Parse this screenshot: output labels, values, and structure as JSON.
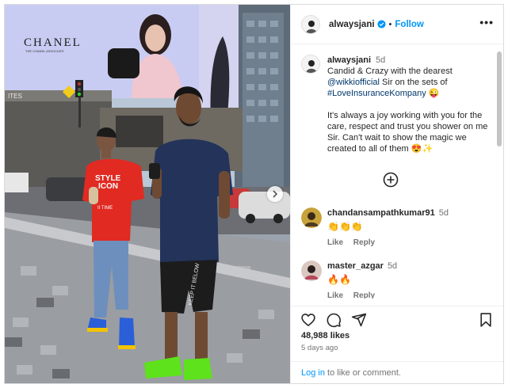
{
  "post": {
    "username": "alwaysjani",
    "follow_label": "Follow",
    "more_label": "•••"
  },
  "photo": {
    "billboard_brand": "CHANEL",
    "billboard_sub": "THE CHANEL ASSOCIATE",
    "storefront_text": "ITES",
    "shirt_text_line1": "STYLE",
    "shirt_text_line2": "ICON",
    "shirt_text_line3": "II TIME",
    "shorts_text": "KEEP IT BELOW"
  },
  "caption": {
    "username": "alwaysjani",
    "time": "5d",
    "line1": "Candid & Crazy with the dearest",
    "mention": "@wikkiofficial",
    "line2": " Sir on the sets of",
    "hashtag": "#LoveInsuranceKompany",
    "emoji1": "😜",
    "para2": "It's always a joy working with you for the care, respect and trust you shower on me Sir. Can't wait to show the magic we created to all of them",
    "emoji2": "😍✨"
  },
  "comments": [
    {
      "username": "chandansampathkumar91",
      "time": "5d",
      "text": "👏👏👏",
      "like_label": "Like",
      "reply_label": "Reply"
    },
    {
      "username": "master_azgar",
      "time": "5d",
      "text": "🔥🔥",
      "like_label": "Like",
      "reply_label": "Reply"
    }
  ],
  "stats": {
    "likes": "48,988 likes",
    "ago": "5 days ago"
  },
  "login": {
    "link": "Log in",
    "rest": " to like or comment."
  },
  "colors": {
    "accent": "#0095f6",
    "link": "#00376b",
    "muted": "#737373"
  },
  "icons": [
    "heart-icon",
    "comment-icon",
    "share-icon",
    "bookmark-icon",
    "add-circle-icon",
    "verified-icon",
    "chevron-right-icon"
  ]
}
